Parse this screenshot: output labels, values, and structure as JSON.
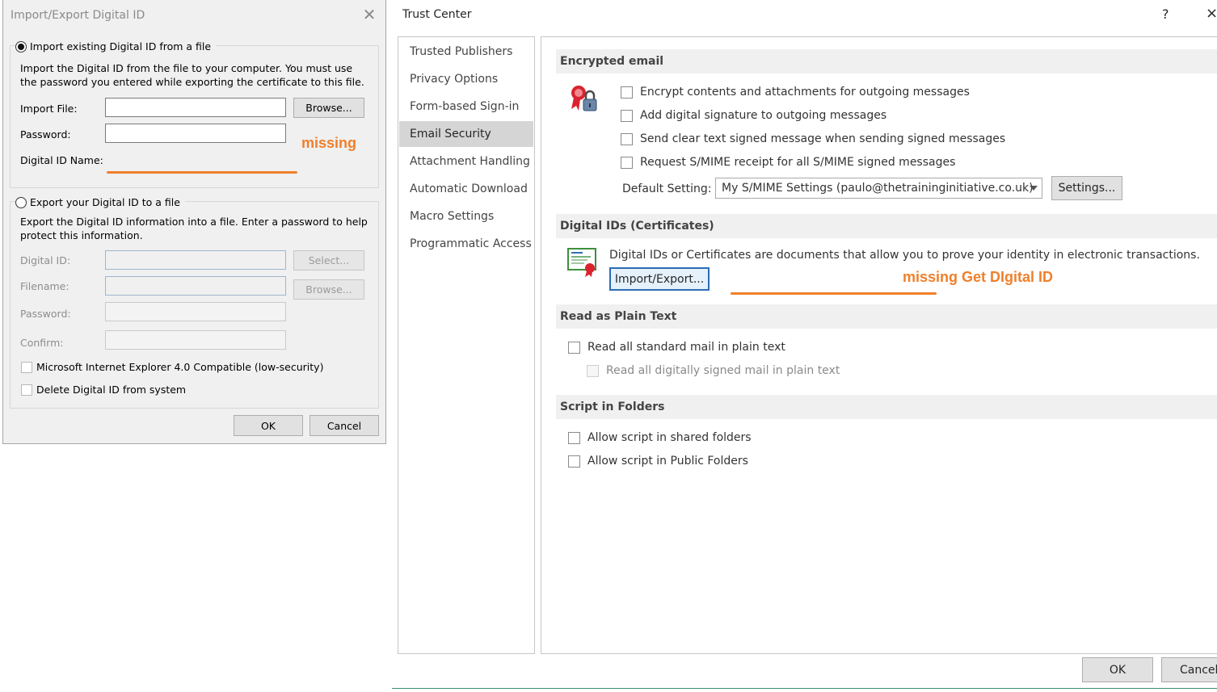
{
  "import_export_dialog": {
    "title": "Import/Export Digital ID",
    "import_section": {
      "radio_label": "Import existing Digital ID from a file",
      "description": "Import the Digital ID from the file to your computer. You must use the password you entered while exporting the certificate to this file.",
      "import_file_label": "Import File:",
      "browse_label": "Browse...",
      "password_label": "Password:",
      "digital_id_name_label": "Digital ID Name:"
    },
    "export_section": {
      "radio_label": "Export your Digital ID to a file",
      "description": "Export the Digital ID information into a file. Enter a password to help protect this information.",
      "digital_id_label": "Digital ID:",
      "select_label": "Select...",
      "filename_label": "Filename:",
      "browse_label": "Browse...",
      "password_label": "Password:",
      "confirm_label": "Confirm:",
      "ie_compat_label": "Microsoft Internet Explorer 4.0 Compatible (low-security)",
      "delete_label": "Delete Digital ID from system"
    },
    "ok_label": "OK",
    "cancel_label": "Cancel",
    "annotation": "missing"
  },
  "trust_center": {
    "title": "Trust Center",
    "help": "?",
    "close": "×",
    "nav": [
      {
        "label": "Trusted Publishers",
        "active": false
      },
      {
        "label": "Privacy Options",
        "active": false
      },
      {
        "label": "Form-based Sign-in",
        "active": false
      },
      {
        "label": "Email Security",
        "active": true
      },
      {
        "label": "Attachment Handling",
        "active": false
      },
      {
        "label": "Automatic Download",
        "active": false
      },
      {
        "label": "Macro Settings",
        "active": false
      },
      {
        "label": "Programmatic Access",
        "active": false
      }
    ],
    "encrypted_email": {
      "heading": "Encrypted email",
      "options": [
        "Encrypt contents and attachments for outgoing messages",
        "Add digital signature to outgoing messages",
        "Send clear text signed message when sending signed messages",
        "Request S/MIME receipt for all S/MIME signed messages"
      ],
      "default_setting_label": "Default Setting:",
      "default_setting_value": "My S/MIME Settings (paulo@thetraininginitiative.co.uk)",
      "settings_button": "Settings..."
    },
    "digital_ids": {
      "heading": "Digital IDs (Certificates)",
      "description": "Digital IDs or Certificates are documents that allow you to prove your identity in electronic transactions.",
      "import_export_button": "Import/Export...",
      "annotation": "missing Get DIgital ID"
    },
    "plain_text": {
      "heading": "Read as Plain Text",
      "read_standard": "Read all standard mail in plain text",
      "read_signed": "Read all digitally signed mail in plain text"
    },
    "script_in_folders": {
      "heading": "Script in Folders",
      "shared": "Allow script in shared folders",
      "public": "Allow script in Public Folders"
    },
    "ok_label": "OK",
    "cancel_label": "Cancel"
  }
}
